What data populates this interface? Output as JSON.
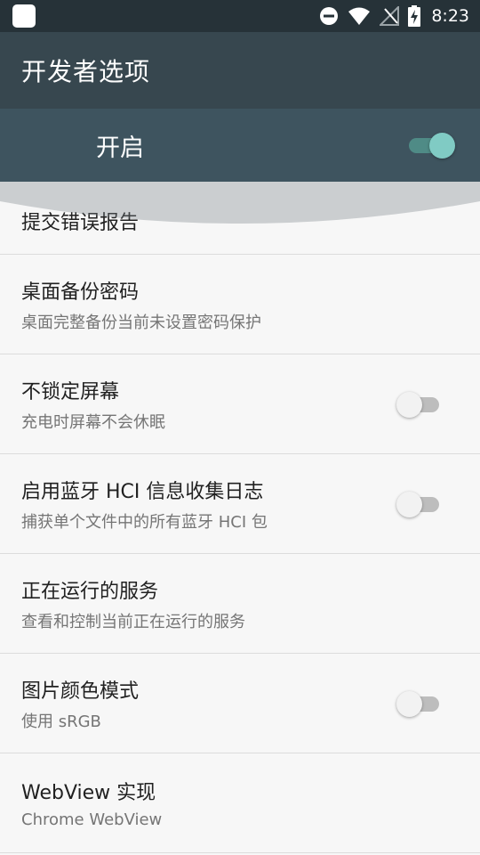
{
  "status_bar": {
    "time": "8:23",
    "icons": [
      "app-notification-icon",
      "do-not-disturb-icon",
      "wifi-icon",
      "no-signal-icon",
      "battery-charging-icon"
    ]
  },
  "toolbar": {
    "title": "开发者选项"
  },
  "master_switch": {
    "label": "开启",
    "state": "on"
  },
  "items": [
    {
      "title": "提交错误报告",
      "summary": "",
      "switch": null
    },
    {
      "title": "桌面备份密码",
      "summary": "桌面完整备份当前未设置密码保护",
      "switch": null
    },
    {
      "title": "不锁定屏幕",
      "summary": "充电时屏幕不会休眠",
      "switch": "off"
    },
    {
      "title": "启用蓝牙 HCI 信息收集日志",
      "summary": "捕获单个文件中的所有蓝牙 HCI 包",
      "switch": "off"
    },
    {
      "title": "正在运行的服务",
      "summary": "查看和控制当前正在运行的服务",
      "switch": null
    },
    {
      "title": "图片颜色模式",
      "summary": "使用 sRGB",
      "switch": "off"
    },
    {
      "title": "WebView 实现",
      "summary": "Chrome WebView",
      "switch": null
    }
  ],
  "colors": {
    "status_bar": "#263238",
    "toolbar": "#37474f",
    "master_bar": "#3e545f",
    "accent": "#80cbc4",
    "background": "#f7f7f7"
  }
}
